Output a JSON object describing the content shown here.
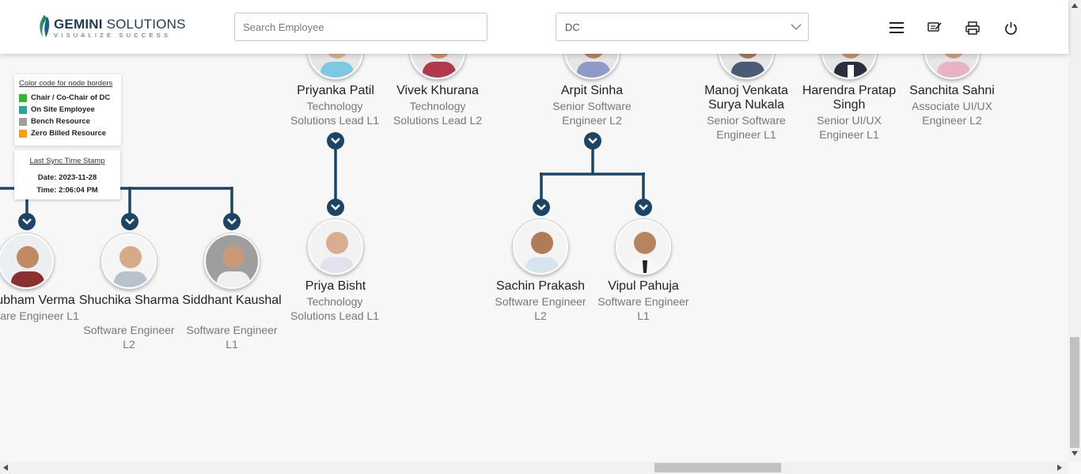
{
  "header": {
    "logo": {
      "name_bold": "GEMINI",
      "name_rest": " SOLUTIONS",
      "tagline": "VISUALIZE SUCCESS"
    },
    "search": {
      "placeholder": "Search Employee",
      "value": ""
    },
    "department_select": {
      "value": "DC"
    },
    "icons": [
      "menu-icon",
      "feedback-icon",
      "print-icon",
      "power-icon"
    ]
  },
  "legend": {
    "title": "Color code for node borders",
    "items": [
      {
        "label": "Chair / Co-Chair of DC",
        "color": "#2db82d"
      },
      {
        "label": "On Site Employee",
        "color": "#26a69a"
      },
      {
        "label": "Bench Resource",
        "color": "#9e9e9e"
      },
      {
        "label": "Zero Billed Resource",
        "color": "#f5a100"
      }
    ]
  },
  "sync": {
    "title": "Last Sync Time Stamp",
    "date": "Date: 2023-11-28",
    "time": "Time: 2:06:04 PM"
  },
  "colors": {
    "connector": "#1b4566",
    "toggle": "#1b4566"
  },
  "nodes": {
    "priyanka": {
      "name": "Priyanka Patil",
      "role": "Technology Solutions Lead L1"
    },
    "vivek": {
      "name": "Vivek Khurana",
      "role": "Technology Solutions Lead L2"
    },
    "arpit": {
      "name": "Arpit Sinha",
      "role": "Senior Software Engineer L2"
    },
    "manoj": {
      "name": "Manoj Venkata Surya Nukala",
      "role": "Senior Software Engineer L1"
    },
    "harendra": {
      "name": "Harendra Pratap Singh",
      "role": "Senior UI/UX Engineer L1"
    },
    "sanchita": {
      "name": "Sanchita Sahni",
      "role": "Associate UI/UX Engineer L2"
    },
    "shubham": {
      "name": "ubham Verma",
      "role": "ware Engineer L1"
    },
    "shuchika": {
      "name": "Shuchika Sharma",
      "role": "Software Engineer L2"
    },
    "siddhant": {
      "name": "Siddhant Kaushal",
      "role": "Software Engineer L1"
    },
    "priya": {
      "name": "Priya Bisht",
      "role": "Technology Solutions Lead L1"
    },
    "sachin": {
      "name": "Sachin Prakash",
      "role": "Software Engineer L2"
    },
    "vipul": {
      "name": "Vipul Pahuja",
      "role": "Software Engineer L1"
    }
  }
}
